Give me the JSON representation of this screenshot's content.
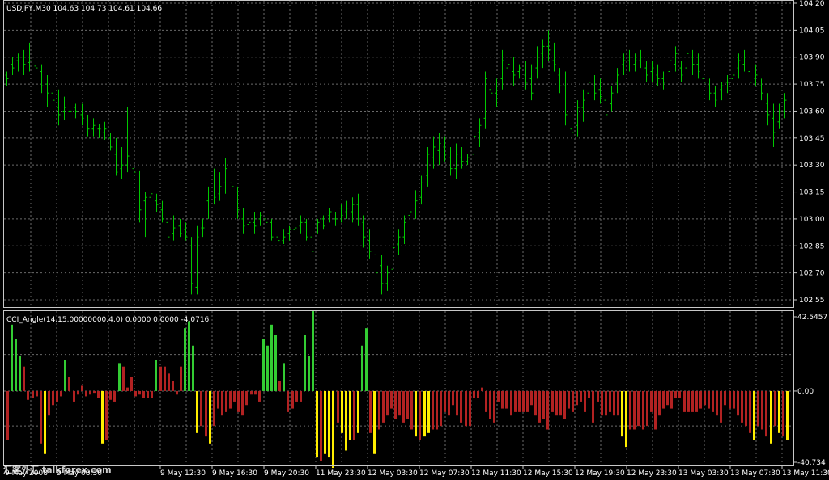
{
  "colors": {
    "price_bar": "#00c800",
    "hist_green": "#33cc33",
    "hist_red": "#b22222",
    "hist_yellow": "#ffee00",
    "grid": "#6a6a6a",
    "frame": "#c8c8c8"
  },
  "main": {
    "title": "USDJPY,M30  104.63 104.73 104.61 104.66",
    "y_ticks": [
      "104.20",
      "104.05",
      "103.90",
      "103.75",
      "103.60",
      "103.45",
      "103.30",
      "103.15",
      "103.00",
      "102.85",
      "102.70",
      "102.55"
    ]
  },
  "indicator": {
    "title": "CCI_Angle(14,15.00000000,4,0) 0.0000 0.0000 -4.0716",
    "y_ticks": [
      "42.5457",
      "0.00",
      "-40.734"
    ]
  },
  "x_labels": [
    "9 May 2008",
    "9 May 08:30",
    "9 May 12:30",
    "9 May 16:30",
    "9 May 20:30",
    "11 May 23:30",
    "12 May 03:30",
    "12 May 07:30",
    "12 May 11:30",
    "12 May 15:30",
    "12 May 19:30",
    "12 May 23:30",
    "13 May 03:30",
    "13 May 07:30",
    "13 May 11:30"
  ],
  "watermark": "汇客外汇 talkforex.com",
  "chart_data": [
    {
      "type": "bar",
      "subtype": "ohlc",
      "title": "USDJPY,M30  104.63 104.73 104.61 104.66",
      "ylim": [
        102.51,
        104.22
      ],
      "grid": true,
      "bars": [
        [
          103.8,
          103.82,
          103.74,
          103.78
        ],
        [
          103.86,
          103.9,
          103.8,
          103.84
        ],
        [
          103.88,
          103.92,
          103.82,
          103.9
        ],
        [
          103.9,
          103.94,
          103.8,
          103.86
        ],
        [
          103.87,
          103.98,
          103.82,
          103.88
        ],
        [
          103.85,
          103.9,
          103.78,
          103.84
        ],
        [
          103.82,
          103.86,
          103.7,
          103.74
        ],
        [
          103.75,
          103.8,
          103.62,
          103.7
        ],
        [
          103.7,
          103.76,
          103.6,
          103.66
        ],
        [
          103.62,
          103.72,
          103.52,
          103.58
        ],
        [
          103.6,
          103.68,
          103.55,
          103.62
        ],
        [
          103.6,
          103.65,
          103.55,
          103.6
        ],
        [
          103.62,
          103.64,
          103.56,
          103.6
        ],
        [
          103.58,
          103.64,
          103.52,
          103.56
        ],
        [
          103.55,
          103.58,
          103.46,
          103.5
        ],
        [
          103.5,
          103.56,
          103.46,
          103.52
        ],
        [
          103.5,
          103.53,
          103.45,
          103.5
        ],
        [
          103.48,
          103.54,
          103.44,
          103.5
        ],
        [
          103.45,
          103.48,
          103.38,
          103.4
        ],
        [
          103.36,
          103.45,
          103.24,
          103.26
        ],
        [
          103.28,
          103.4,
          103.22,
          103.3
        ],
        [
          103.3,
          103.62,
          103.26,
          103.35
        ],
        [
          103.28,
          103.44,
          103.22,
          103.26
        ],
        [
          103.15,
          103.27,
          102.98,
          103.05
        ],
        [
          103.1,
          103.15,
          102.9,
          103.12
        ],
        [
          103.12,
          103.16,
          103.0,
          103.14
        ],
        [
          103.1,
          103.14,
          103.04,
          103.08
        ],
        [
          103.05,
          103.1,
          102.98,
          103.0
        ],
        [
          102.98,
          103.06,
          102.86,
          102.9
        ],
        [
          102.92,
          103.02,
          102.88,
          102.95
        ],
        [
          102.96,
          103.0,
          102.9,
          102.92
        ],
        [
          102.94,
          102.98,
          102.88,
          102.9
        ],
        [
          102.85,
          102.9,
          102.58,
          102.64
        ],
        [
          102.62,
          102.96,
          102.58,
          102.9
        ],
        [
          102.95,
          103.0,
          102.9,
          102.95
        ],
        [
          103.1,
          103.18,
          103.0,
          103.15
        ],
        [
          103.15,
          103.28,
          103.08,
          103.12
        ],
        [
          103.14,
          103.26,
          103.1,
          103.18
        ],
        [
          103.2,
          103.34,
          103.14,
          103.28
        ],
        [
          103.2,
          103.26,
          103.12,
          103.18
        ],
        [
          103.15,
          103.18,
          103.0,
          103.05
        ],
        [
          103.0,
          103.06,
          102.92,
          102.96
        ],
        [
          102.97,
          103.02,
          102.94,
          102.98
        ],
        [
          102.98,
          103.04,
          102.92,
          102.96
        ],
        [
          103.0,
          103.04,
          102.96,
          103.02
        ],
        [
          103.0,
          103.02,
          102.96,
          102.98
        ],
        [
          102.98,
          103.0,
          102.88,
          102.9
        ],
        [
          102.9,
          102.92,
          102.86,
          102.88
        ],
        [
          102.88,
          102.94,
          102.86,
          102.9
        ],
        [
          102.92,
          102.96,
          102.88,
          102.94
        ],
        [
          102.94,
          103.06,
          102.9,
          102.95
        ],
        [
          102.96,
          103.02,
          102.92,
          102.98
        ],
        [
          102.98,
          103.0,
          102.88,
          102.9
        ],
        [
          102.9,
          102.96,
          102.78,
          102.82
        ],
        [
          102.96,
          103.0,
          102.92,
          102.98
        ],
        [
          103.0,
          103.02,
          102.94,
          102.96
        ],
        [
          103.02,
          103.06,
          102.98,
          103.04
        ],
        [
          103.0,
          103.04,
          102.96,
          103.0
        ],
        [
          103.06,
          103.08,
          102.98,
          103.02
        ],
        [
          103.04,
          103.1,
          103.0,
          103.06
        ],
        [
          103.04,
          103.12,
          102.98,
          103.08
        ],
        [
          103.08,
          103.14,
          102.96,
          103.0
        ],
        [
          102.98,
          103.02,
          102.84,
          102.9
        ],
        [
          102.88,
          102.94,
          102.78,
          102.82
        ],
        [
          102.8,
          102.86,
          102.66,
          102.7
        ],
        [
          102.74,
          102.8,
          102.58,
          102.64
        ],
        [
          102.64,
          102.74,
          102.6,
          102.7
        ],
        [
          102.72,
          102.88,
          102.68,
          102.84
        ],
        [
          102.86,
          102.94,
          102.8,
          102.9
        ],
        [
          102.9,
          103.02,
          102.86,
          102.98
        ],
        [
          103.02,
          103.1,
          102.96,
          103.04
        ],
        [
          103.06,
          103.16,
          103.0,
          103.1
        ],
        [
          103.12,
          103.24,
          103.08,
          103.2
        ],
        [
          103.24,
          103.4,
          103.18,
          103.36
        ],
        [
          103.34,
          103.46,
          103.28,
          103.4
        ],
        [
          103.38,
          103.48,
          103.3,
          103.42
        ],
        [
          103.4,
          103.46,
          103.32,
          103.36
        ],
        [
          103.34,
          103.4,
          103.24,
          103.28
        ],
        [
          103.28,
          103.42,
          103.22,
          103.36
        ],
        [
          103.34,
          103.4,
          103.28,
          103.32
        ],
        [
          103.32,
          103.36,
          103.3,
          103.34
        ],
        [
          103.36,
          103.48,
          103.32,
          103.46
        ],
        [
          103.48,
          103.56,
          103.4,
          103.52
        ],
        [
          103.56,
          103.82,
          103.5,
          103.78
        ],
        [
          103.72,
          103.8,
          103.66,
          103.7
        ],
        [
          103.7,
          103.78,
          103.62,
          103.74
        ],
        [
          103.78,
          103.94,
          103.72,
          103.88
        ],
        [
          103.84,
          103.92,
          103.78,
          103.86
        ],
        [
          103.82,
          103.9,
          103.74,
          103.8
        ],
        [
          103.82,
          103.86,
          103.78,
          103.84
        ],
        [
          103.8,
          103.88,
          103.72,
          103.76
        ],
        [
          103.78,
          103.86,
          103.66,
          103.7
        ],
        [
          103.84,
          103.96,
          103.78,
          103.9
        ],
        [
          103.92,
          104.0,
          103.84,
          103.96
        ],
        [
          103.96,
          104.05,
          103.88,
          103.94
        ],
        [
          103.88,
          103.98,
          103.82,
          103.86
        ],
        [
          103.8,
          103.84,
          103.7,
          103.74
        ],
        [
          103.74,
          103.82,
          103.52,
          103.58
        ],
        [
          103.5,
          103.56,
          103.28,
          103.48
        ],
        [
          103.52,
          103.66,
          103.46,
          103.62
        ],
        [
          103.62,
          103.72,
          103.54,
          103.66
        ],
        [
          103.7,
          103.82,
          103.64,
          103.76
        ],
        [
          103.74,
          103.8,
          103.66,
          103.7
        ],
        [
          103.72,
          103.78,
          103.64,
          103.68
        ],
        [
          103.66,
          103.7,
          103.54,
          103.58
        ],
        [
          103.64,
          103.74,
          103.6,
          103.7
        ],
        [
          103.76,
          103.84,
          103.7,
          103.8
        ],
        [
          103.86,
          103.92,
          103.8,
          103.88
        ],
        [
          103.88,
          103.94,
          103.82,
          103.9
        ],
        [
          103.86,
          103.92,
          103.82,
          103.88
        ],
        [
          103.88,
          103.94,
          103.84,
          103.9
        ],
        [
          103.84,
          103.88,
          103.76,
          103.8
        ],
        [
          103.82,
          103.88,
          103.76,
          103.84
        ],
        [
          103.8,
          103.86,
          103.74,
          103.78
        ],
        [
          103.78,
          103.82,
          103.72,
          103.76
        ],
        [
          103.82,
          103.92,
          103.78,
          103.88
        ],
        [
          103.86,
          103.96,
          103.82,
          103.92
        ],
        [
          103.84,
          103.88,
          103.76,
          103.8
        ],
        [
          103.84,
          103.98,
          103.8,
          103.92
        ],
        [
          103.9,
          103.94,
          103.8,
          103.86
        ],
        [
          103.86,
          103.92,
          103.78,
          103.82
        ],
        [
          103.78,
          103.84,
          103.72,
          103.76
        ],
        [
          103.74,
          103.78,
          103.66,
          103.7
        ],
        [
          103.7,
          103.74,
          103.62,
          103.66
        ],
        [
          103.72,
          103.76,
          103.66,
          103.74
        ],
        [
          103.76,
          103.8,
          103.7,
          103.76
        ],
        [
          103.78,
          103.84,
          103.72,
          103.8
        ],
        [
          103.84,
          103.92,
          103.78,
          103.88
        ],
        [
          103.86,
          103.94,
          103.82,
          103.9
        ],
        [
          103.82,
          103.88,
          103.7,
          103.76
        ],
        [
          103.78,
          103.86,
          103.74,
          103.8
        ],
        [
          103.74,
          103.78,
          103.66,
          103.7
        ],
        [
          103.64,
          103.7,
          103.52,
          103.58
        ],
        [
          103.56,
          103.64,
          103.4,
          103.48
        ],
        [
          103.54,
          103.64,
          103.5,
          103.6
        ],
        [
          103.6,
          103.7,
          103.56,
          103.66
        ]
      ]
    },
    {
      "type": "bar",
      "title": "CCI_Angle(14,15.00000000,4,0) 0.0000 0.0000 -4.0716",
      "ylim": [
        -40.734,
        42.5457
      ],
      "grid": true,
      "values": [
        -28,
        38,
        30,
        20,
        14,
        -5,
        -4,
        -3,
        -30,
        -36,
        -14,
        -8,
        -6,
        -3,
        18,
        8,
        -6,
        -2,
        3,
        -3,
        -2,
        -1,
        -4,
        -30,
        -28,
        -5,
        -6,
        16,
        14,
        2,
        8,
        -3,
        -2,
        -4,
        -4,
        -4,
        18,
        14,
        14,
        10,
        6,
        -2,
        14,
        36,
        40,
        26,
        -24,
        -20,
        -26,
        -30,
        -20,
        -10,
        -14,
        -12,
        -10,
        -6,
        -12,
        -14,
        -8,
        -2,
        -2,
        -6,
        30,
        26,
        38,
        32,
        6,
        16,
        -12,
        -10,
        -6,
        -6,
        32,
        20,
        46,
        -38,
        -40,
        -36,
        -38,
        -44,
        -18,
        -24,
        -34,
        -28,
        -28,
        -24,
        26,
        36,
        -24,
        -36,
        -22,
        -18,
        -14,
        -10,
        -16,
        -14,
        -18,
        -16,
        -22,
        -26,
        -28,
        -26,
        -24,
        -22,
        -22,
        -20,
        -12,
        -14,
        -8,
        -14,
        -18,
        -20,
        -20,
        -4,
        -4,
        2,
        -12,
        -16,
        -18,
        -6,
        -10,
        -10,
        -14,
        -12,
        -12,
        -12,
        -12,
        -8,
        -14,
        -18,
        -16,
        -22,
        -12,
        -14,
        -14,
        -16,
        -10,
        -12,
        -8,
        -6,
        -12,
        -4,
        -18,
        -6,
        -14,
        -14,
        -12,
        -14,
        -14,
        -26,
        -32,
        -22,
        -22,
        -20,
        -22,
        -20,
        -12,
        -22,
        -14,
        -10,
        -8,
        -10,
        -4,
        -4,
        -12,
        -12,
        -12,
        -12,
        -10,
        -8,
        -10,
        -12,
        -14,
        -18,
        -8,
        -10,
        -10,
        -14,
        -18,
        -20,
        -24,
        -28,
        -20,
        -22,
        -26,
        -30,
        -20,
        -24,
        -26,
        -28
      ]
    }
  ]
}
